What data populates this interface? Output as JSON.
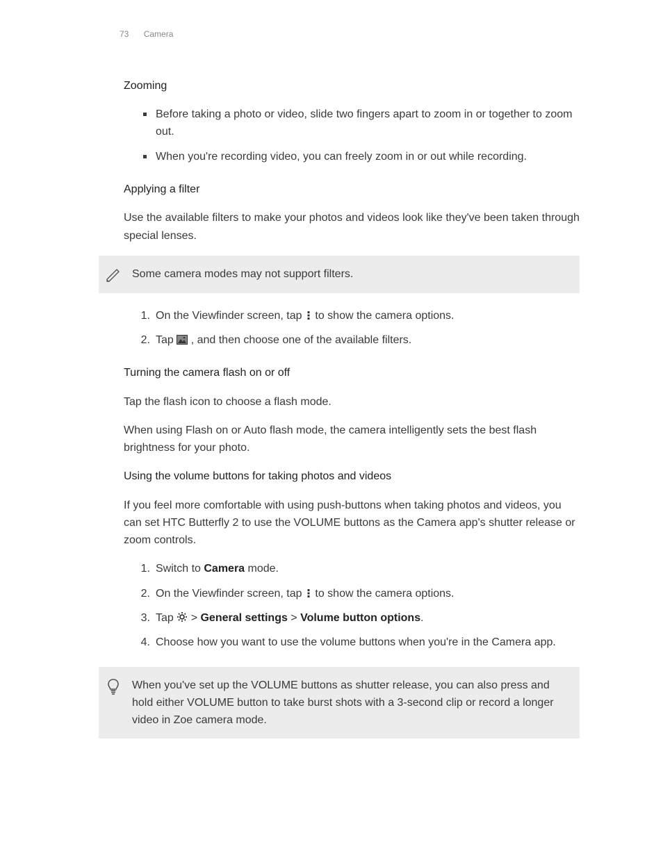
{
  "header": {
    "page_number": "73",
    "chapter": "Camera"
  },
  "sections": {
    "zooming": {
      "title": "Zooming",
      "bullets": [
        "Before taking a photo or video, slide two fingers apart to zoom in or together to zoom out.",
        "When you're recording video, you can freely zoom in or out while recording."
      ]
    },
    "filter": {
      "title": "Applying a filter",
      "intro": "Use the available filters to make your photos and videos look like they've been taken through special lenses.",
      "note": "Some camera modes may not support filters.",
      "step1_a": "On the Viewfinder screen, tap ",
      "step1_b": " to show the camera options.",
      "step2_a": "Tap ",
      "step2_b": " , and then choose one of the available filters."
    },
    "flash": {
      "title": "Turning the camera flash on or off",
      "p1": "Tap the flash icon to choose a flash mode.",
      "p2": "When using Flash on or Auto flash mode, the camera intelligently sets the best flash brightness for your photo."
    },
    "volume": {
      "title": "Using the volume buttons for taking photos and videos",
      "intro": "If you feel more comfortable with using push-buttons when taking photos and videos, you can set HTC Butterfly 2 to use the VOLUME buttons as the Camera app's shutter release or zoom controls.",
      "step1_a": "Switch to ",
      "step1_bold": "Camera",
      "step1_b": " mode.",
      "step2_a": "On the Viewfinder screen, tap ",
      "step2_b": " to show the camera options.",
      "step3_a": "Tap ",
      "step3_b": " > ",
      "step3_gs": "General settings",
      "step3_c": " > ",
      "step3_vbo": "Volume button options",
      "step3_d": ".",
      "step4": "Choose how you want to use the volume buttons when you're in the Camera app.",
      "tip": "When you've set up the VOLUME buttons as shutter release, you can also press and hold either VOLUME button to take burst shots with a 3-second clip or record a longer video in Zoe camera mode."
    }
  }
}
